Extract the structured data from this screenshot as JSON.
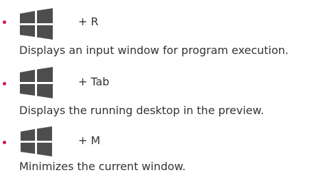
{
  "colors": {
    "bullet": "#c8174a",
    "logo": "#4d4d4d",
    "text": "#333333"
  },
  "shortcuts": [
    {
      "icon": "windows-logo-icon",
      "key": "+ R",
      "description": "Displays an input window for program execution."
    },
    {
      "icon": "windows-logo-icon",
      "key": "+ Tab",
      "description": "Displays the running desktop in the preview."
    },
    {
      "icon": "windows-logo-icon",
      "key": "+ M",
      "description": "Minimizes the current window."
    }
  ]
}
